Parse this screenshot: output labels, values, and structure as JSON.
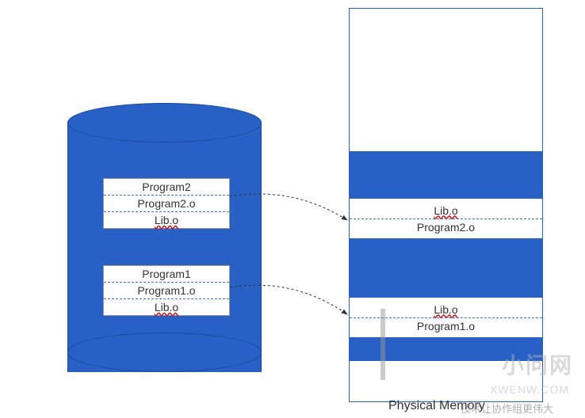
{
  "cylinder": {
    "box2": {
      "line1": "Program2",
      "line2": "Program2.o",
      "line3": "Lib.o"
    },
    "box1": {
      "line1": "Program1",
      "line2": "Program1.o",
      "line3": "Lib.o"
    }
  },
  "memory": {
    "label": "Physical Memory",
    "segment2": {
      "line1": "Lib.o",
      "line2": "Program2.o"
    },
    "segment1": {
      "line1": "Lib.o",
      "line2": "Program1.o"
    }
  },
  "watermarks": {
    "w1": "小问网",
    "w2": "XWENW.COM",
    "w3": "技术让协作组更伟大"
  },
  "colors": {
    "blue": "#2860c5"
  }
}
